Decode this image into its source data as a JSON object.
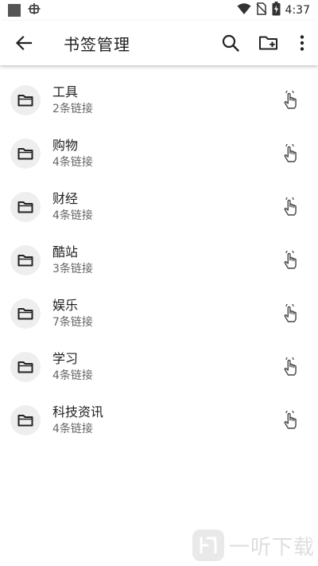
{
  "status_bar": {
    "time": "4:37",
    "icons": [
      "square-notification-icon",
      "bug-notification-icon",
      "wifi-icon",
      "no-sim-icon",
      "battery-charging-icon"
    ]
  },
  "app_bar": {
    "title": "书签管理",
    "icons": [
      "back-arrow-icon",
      "search-icon",
      "new-folder-icon",
      "more-vert-icon"
    ]
  },
  "folders": [
    {
      "name": "工具",
      "count": "2条链接"
    },
    {
      "name": "购物",
      "count": "4条链接"
    },
    {
      "name": "财经",
      "count": "4条链接"
    },
    {
      "name": "酷站",
      "count": "3条链接"
    },
    {
      "name": "娱乐",
      "count": "7条链接"
    },
    {
      "name": "学习",
      "count": "4条链接"
    },
    {
      "name": "科技资讯",
      "count": "4条链接"
    }
  ],
  "watermark": {
    "text": "一听下载"
  },
  "colors": {
    "background": "#ffffff",
    "folder_circle": "#eeeeee",
    "primary_text": "#1f1f1f",
    "secondary_text": "#666666"
  }
}
